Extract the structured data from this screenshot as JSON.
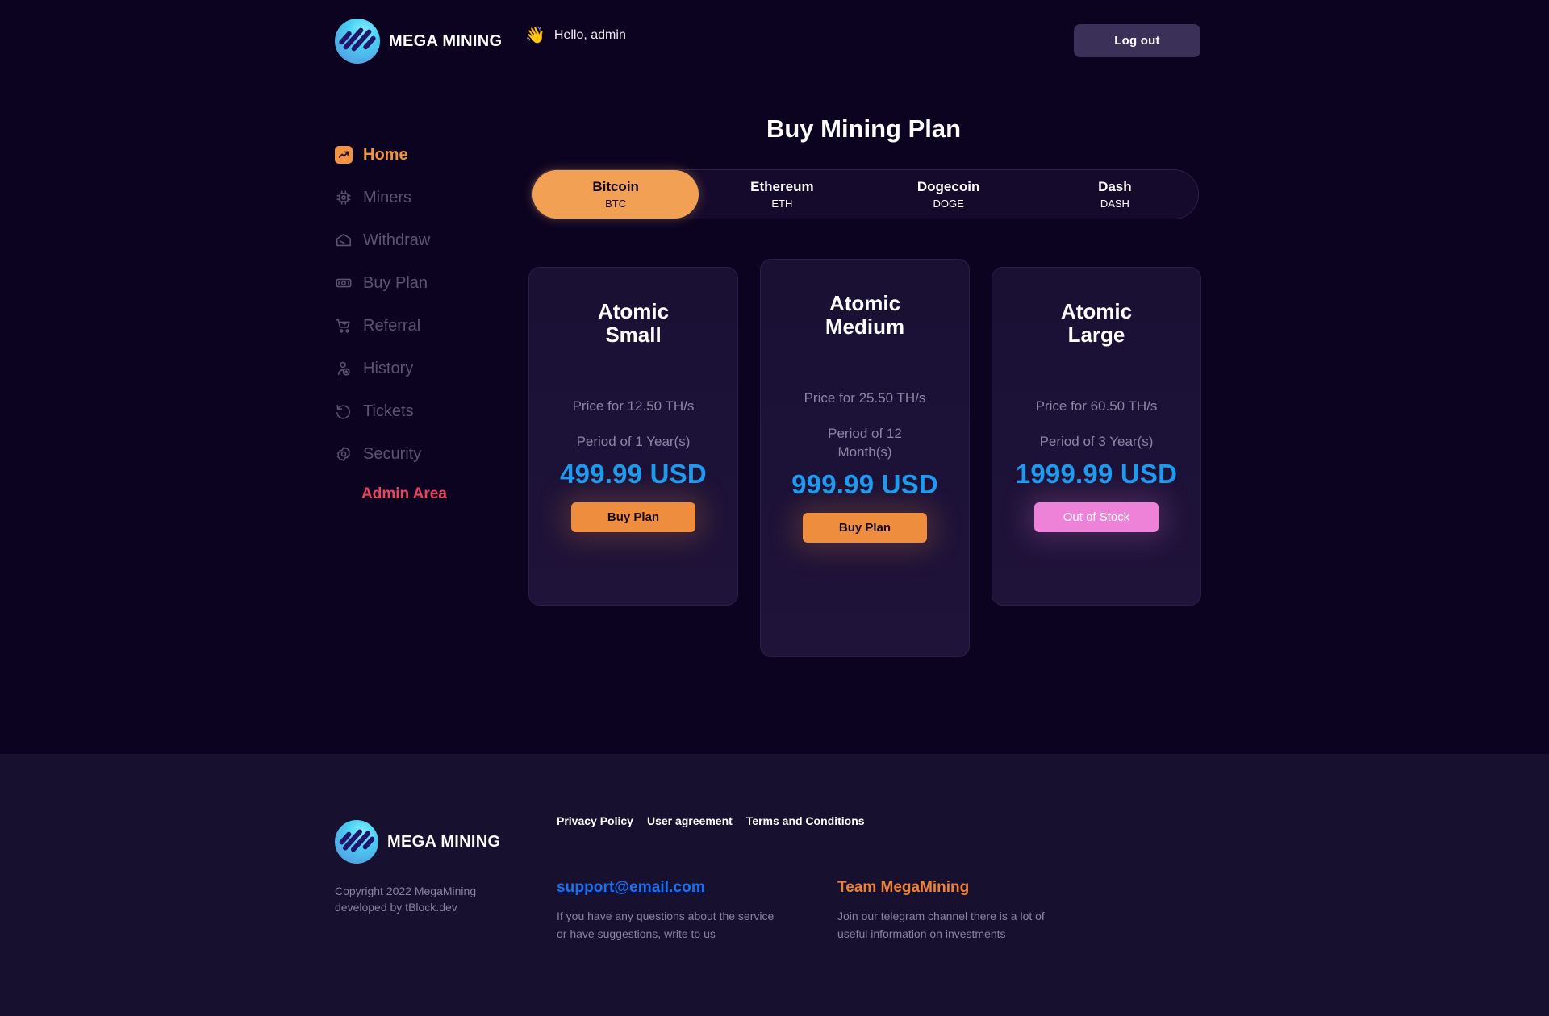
{
  "header": {
    "brand_name": "MEGA MINING",
    "wave_icon": "waving-hand",
    "greeting": "Hello, admin",
    "logout_label": "Log out"
  },
  "sidebar": {
    "items": [
      {
        "label": "Home",
        "icon": "trend-up-icon",
        "active": true
      },
      {
        "label": "Miners",
        "icon": "cpu-chip-icon",
        "active": false
      },
      {
        "label": "Withdraw",
        "icon": "withdraw-envelope-icon",
        "active": false
      },
      {
        "label": "Buy Plan",
        "icon": "banknote-icon",
        "active": false
      },
      {
        "label": "Referral",
        "icon": "cart-plus-icon",
        "active": false
      },
      {
        "label": "History",
        "icon": "user-add-icon",
        "active": false
      },
      {
        "label": "Tickets",
        "icon": "rotate-back-icon",
        "active": false
      },
      {
        "label": "Security",
        "icon": "gear-icon",
        "active": false
      }
    ],
    "admin_label": "Admin Area"
  },
  "main": {
    "title": "Buy Mining Plan",
    "coin_tabs": [
      {
        "name": "Bitcoin",
        "symbol": "BTC",
        "active": true
      },
      {
        "name": "Ethereum",
        "symbol": "ETH",
        "active": false
      },
      {
        "name": "Dogecoin",
        "symbol": "DOGE",
        "active": false
      },
      {
        "name": "Dash",
        "symbol": "DASH",
        "active": false
      }
    ],
    "plans": [
      {
        "name": "Atomic Small",
        "price_line": "Price for 12.50 TH/s",
        "period_line": "Period of 1 Year(s)",
        "period_line2": "",
        "price": "499.99 USD",
        "cta": "Buy Plan",
        "available": true
      },
      {
        "name": "Atomic Medium",
        "price_line": "Price for 25.50 TH/s",
        "period_line": "Period of 12",
        "period_line2": "Month(s)",
        "price": "999.99 USD",
        "cta": "Buy Plan",
        "available": true
      },
      {
        "name": "Atomic Large",
        "price_line": "Price for 60.50 TH/s",
        "period_line": "Period of 3 Year(s)",
        "period_line2": "",
        "price": "1999.99 USD",
        "cta": "Out of Stock",
        "available": false
      }
    ]
  },
  "footer": {
    "brand_name": "MEGA MINING",
    "copyright": "Copyright 2022 MegaMining developed by tBlock.dev",
    "links": [
      "Privacy Policy",
      "User agreement",
      "Terms and Conditions"
    ],
    "support_email": "support@email.com",
    "support_desc": "If you have any questions about the service or have suggestions, write to us",
    "team_title": "Team MegaMining",
    "team_desc": "Join our telegram channel there is a lot of useful information on investments"
  },
  "colors": {
    "background": "#0b0320",
    "footer_background": "#17102e",
    "accent_orange": "#f2933f",
    "price_blue": "#1d9bf0",
    "admin_red": "#e8455f",
    "out_of_stock_pink": "#ee82d9"
  }
}
